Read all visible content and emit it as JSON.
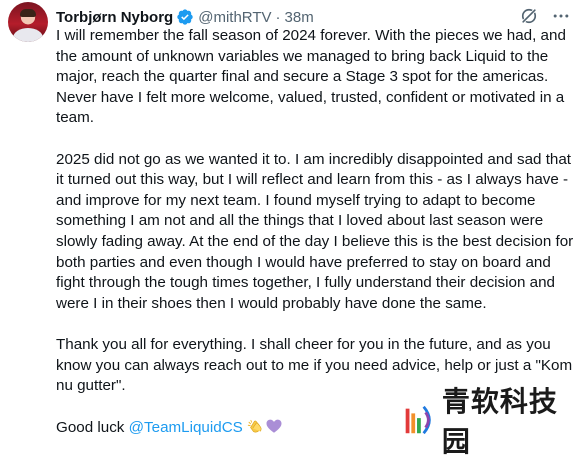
{
  "tweet": {
    "display_name": "Torbjørn Nyborg",
    "handle": "@mithRTV",
    "separator": "·",
    "time": "38m",
    "paragraphs": [
      "I will remember the fall season of 2024 forever. With the pieces we had, and the amount of unknown variables we managed to bring back Liquid to the major, reach the quarter final and secure a Stage 3 spot for the americas. Never have I felt more welcome, valued, trusted, confident or motivated in a team.",
      "2025 did not go as we wanted it to. I am incredibly disappointed and sad that it turned out this way, but I will reflect and learn from this - as I always have - and improve for my next team. I found myself trying to adapt to become something I am not and all the things that I loved about last season were slowly fading away. At the end of the day I believe this is the best decision for both parties and even though I would have preferred to stay on board and fight through the tough times together, I fully understand their decision and were I in their shoes then I would probably have done the same.",
      "Thank you all for everything. I shall cheer for you in the future, and as you know you can always reach out to me if you need advice, help or just a \"Kom nu gutter\"."
    ],
    "closing_prefix": "Good luck ",
    "closing_mention": "@TeamLiquidCS",
    "icons": {
      "verified": "verified-badge-icon",
      "grok": "grok-icon",
      "more": "more-icon",
      "clap": "clapping-hands-emoji",
      "heart": "purple-heart-emoji"
    },
    "colors": {
      "text": "#0f1419",
      "secondary": "#536471",
      "link": "#1d9bf0",
      "verified": "#1d9bf0"
    }
  },
  "watermark": {
    "text": "青软科技园"
  }
}
